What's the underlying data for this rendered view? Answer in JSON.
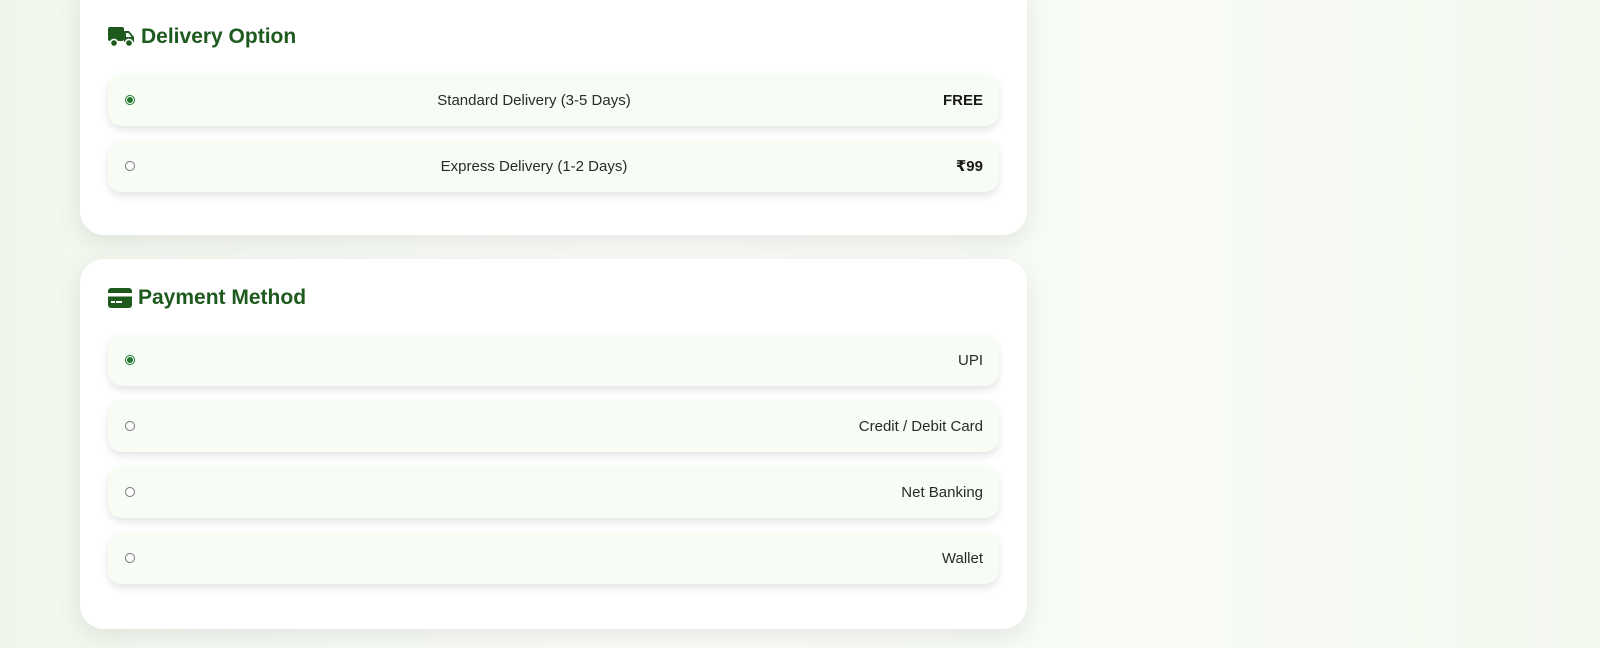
{
  "delivery": {
    "title": "Delivery Option",
    "icon": "truck-icon",
    "options": [
      {
        "label": "Standard Delivery (3-5 Days)",
        "price": "FREE",
        "selected": true
      },
      {
        "label": "Express Delivery (1-2 Days)",
        "price": "₹99",
        "selected": false
      }
    ]
  },
  "payment": {
    "title": "Payment Method",
    "icon": "credit-card-icon",
    "options": [
      {
        "label": "UPI",
        "selected": true
      },
      {
        "label": "Credit / Debit Card",
        "selected": false
      },
      {
        "label": "Net Banking",
        "selected": false
      },
      {
        "label": "Wallet",
        "selected": false
      }
    ]
  },
  "colors": {
    "accent": "#1e5a1e",
    "radio_selected": "#1f7a2e",
    "option_bg": "#f7fcf4"
  }
}
